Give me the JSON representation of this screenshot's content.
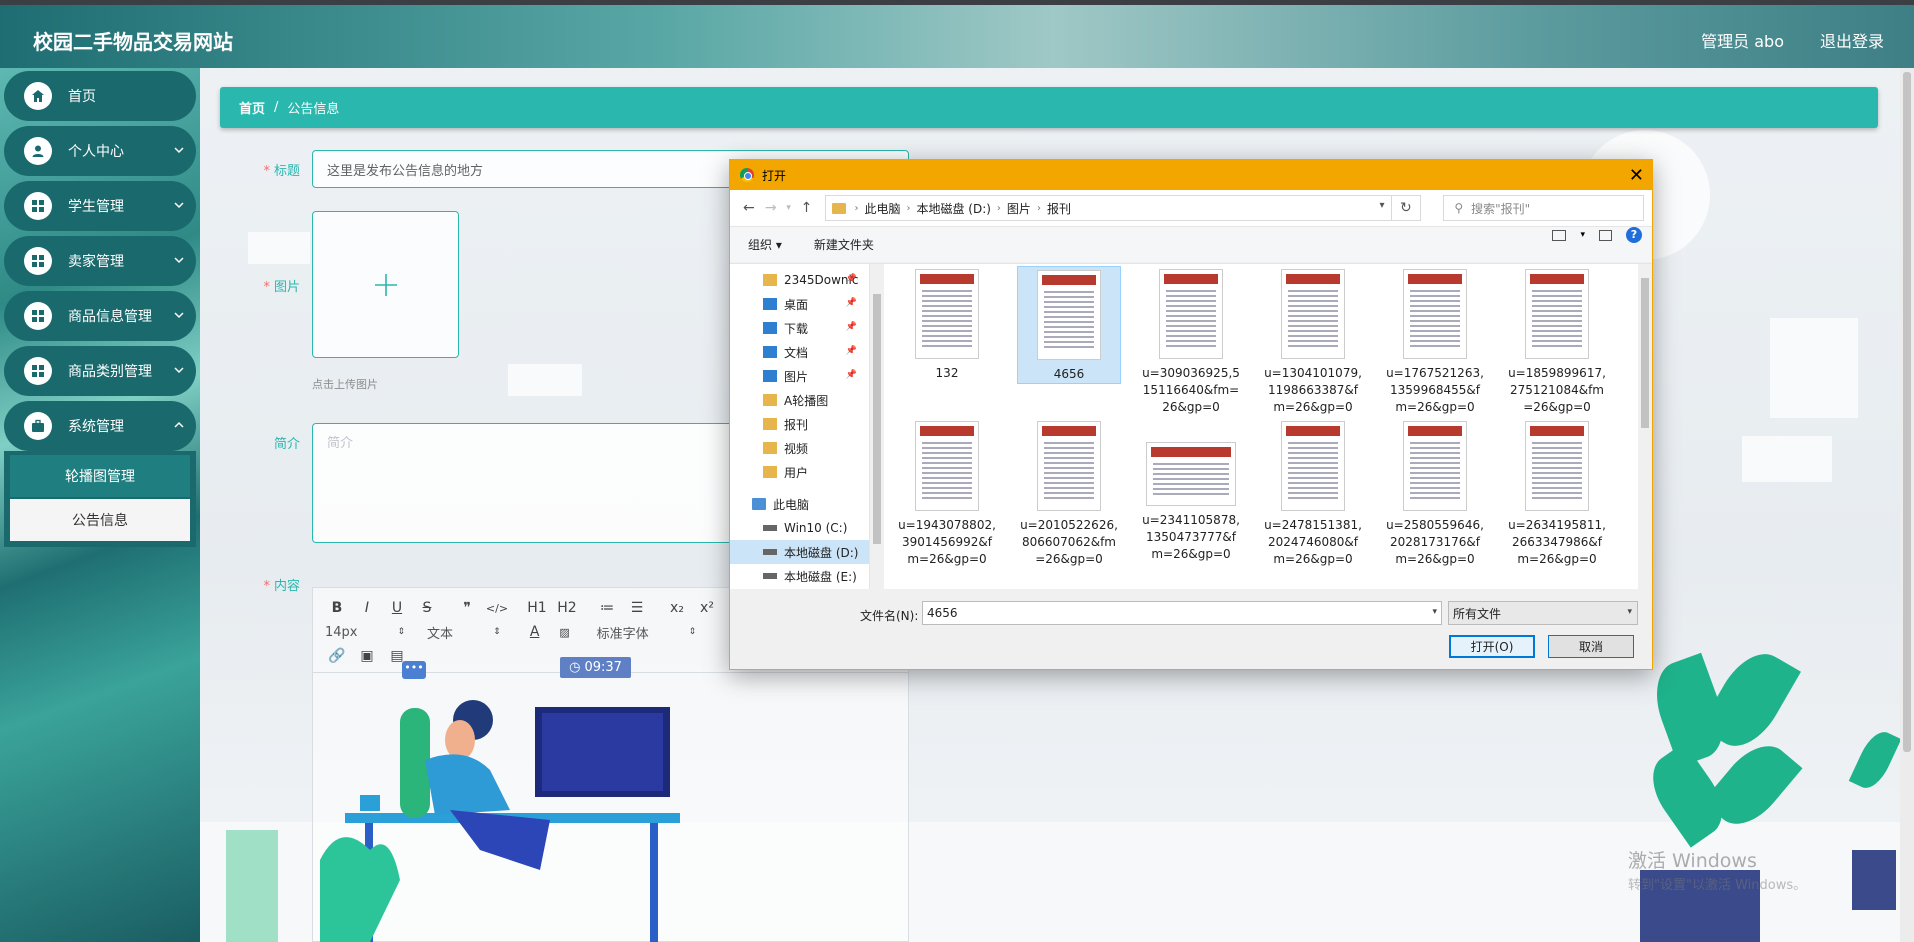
{
  "header": {
    "site_title": "校园二手物品交易网站",
    "admin_label": "管理员 abo",
    "logout_label": "退出登录"
  },
  "sidebar": {
    "items": [
      {
        "label": "首页",
        "icon": "home-icon",
        "expandable": false
      },
      {
        "label": "个人中心",
        "icon": "user-icon",
        "expandable": true
      },
      {
        "label": "学生管理",
        "icon": "grid-icon",
        "expandable": true
      },
      {
        "label": "卖家管理",
        "icon": "grid-icon",
        "expandable": true
      },
      {
        "label": "商品信息管理",
        "icon": "grid-icon",
        "expandable": true
      },
      {
        "label": "商品类别管理",
        "icon": "grid-icon",
        "expandable": true
      },
      {
        "label": "系统管理",
        "icon": "briefcase-icon",
        "expandable": true
      }
    ],
    "submenu": [
      {
        "label": "轮播图管理",
        "active": false
      },
      {
        "label": "公告信息",
        "active": true
      }
    ]
  },
  "breadcrumb": {
    "home": "首页",
    "separator": "/",
    "current": "公告信息"
  },
  "form": {
    "title_label": "标题",
    "title_value": "这里是发布公告信息的地方",
    "image_label": "图片",
    "upload_hint": "点击上传图片",
    "intro_label": "简介",
    "intro_placeholder": "简介",
    "content_label": "内容",
    "required_mark": "*"
  },
  "editor": {
    "toolbar_row1": [
      "B",
      "I",
      "U",
      "S",
      "❞",
      "</>",
      "H1",
      "H2",
      "≔",
      "☰",
      "x₂",
      "x²"
    ],
    "font_size": "14px",
    "text_style": "文本",
    "font_family": "标准字体",
    "clock_time": "09:37",
    "chat_dots": "•••"
  },
  "dialog": {
    "title": "打开",
    "address_crumbs": [
      "此电脑",
      "本地磁盘 (D:)",
      "图片",
      "报刊"
    ],
    "search_placeholder": "搜索\"报刊\"",
    "organize_label": "组织 ▾",
    "new_folder_label": "新建文件夹",
    "nav_items": [
      {
        "label": "2345Downlc",
        "icon": "folder",
        "pinned": true,
        "indent": 1
      },
      {
        "label": "桌面",
        "icon": "blue",
        "pinned": true,
        "indent": 1
      },
      {
        "label": "下载",
        "icon": "blue",
        "pinned": true,
        "indent": 1
      },
      {
        "label": "文档",
        "icon": "blue",
        "pinned": true,
        "indent": 1
      },
      {
        "label": "图片",
        "icon": "blue",
        "pinned": true,
        "indent": 1
      },
      {
        "label": "A轮播图",
        "icon": "folder",
        "pinned": false,
        "indent": 1
      },
      {
        "label": "报刊",
        "icon": "folder",
        "pinned": false,
        "indent": 1
      },
      {
        "label": "视频",
        "icon": "folder",
        "pinned": false,
        "indent": 1
      },
      {
        "label": "用户",
        "icon": "folder",
        "pinned": false,
        "indent": 1
      },
      {
        "label": "此电脑",
        "icon": "pc",
        "pinned": false,
        "indent": 0
      },
      {
        "label": "Win10 (C:)",
        "icon": "drive",
        "pinned": false,
        "indent": 1
      },
      {
        "label": "本地磁盘 (D:)",
        "icon": "drive",
        "pinned": false,
        "indent": 1,
        "selected": true
      },
      {
        "label": "本地磁盘 (E:)",
        "icon": "drive",
        "pinned": false,
        "indent": 1
      }
    ],
    "files": [
      {
        "name": "132",
        "selected": false
      },
      {
        "name": "4656",
        "selected": true
      },
      {
        "name": "u=309036925,5\n15116640&fm=\n26&gp=0",
        "selected": false
      },
      {
        "name": "u=1304101079,\n1198663387&f\nm=26&gp=0",
        "selected": false
      },
      {
        "name": "u=1767521263,\n1359968455&f\nm=26&gp=0",
        "selected": false
      },
      {
        "name": "u=1859899617,\n275121084&fm\n=26&gp=0",
        "selected": false
      },
      {
        "name": "u=1943078802,\n3901456992&f\nm=26&gp=0",
        "selected": false
      },
      {
        "name": "u=2010522626,\n806607062&fm\n=26&gp=0",
        "selected": false
      },
      {
        "name": "u=2341105878,\n1350473777&f\nm=26&gp=0",
        "selected": false,
        "wide": true
      },
      {
        "name": "u=2478151381,\n2024746080&f\nm=26&gp=0",
        "selected": false
      },
      {
        "name": "u=2580559646,\n2028173176&f\nm=26&gp=0",
        "selected": false
      },
      {
        "name": "u=2634195811,\n2663347986&f\nm=26&gp=0",
        "selected": false
      }
    ],
    "filename_label": "文件名(N):",
    "filename_value": "4656",
    "filetype_value": "所有文件",
    "open_label": "打开(O)",
    "cancel_label": "取消"
  },
  "watermark": {
    "line1": "激活 Windows",
    "line2": "转到\"设置\"以激活 Windows。"
  },
  "colors": {
    "accent": "#2ab7ae",
    "sidebar": "#1a6a6d",
    "dialog_title": "#f3a600"
  }
}
